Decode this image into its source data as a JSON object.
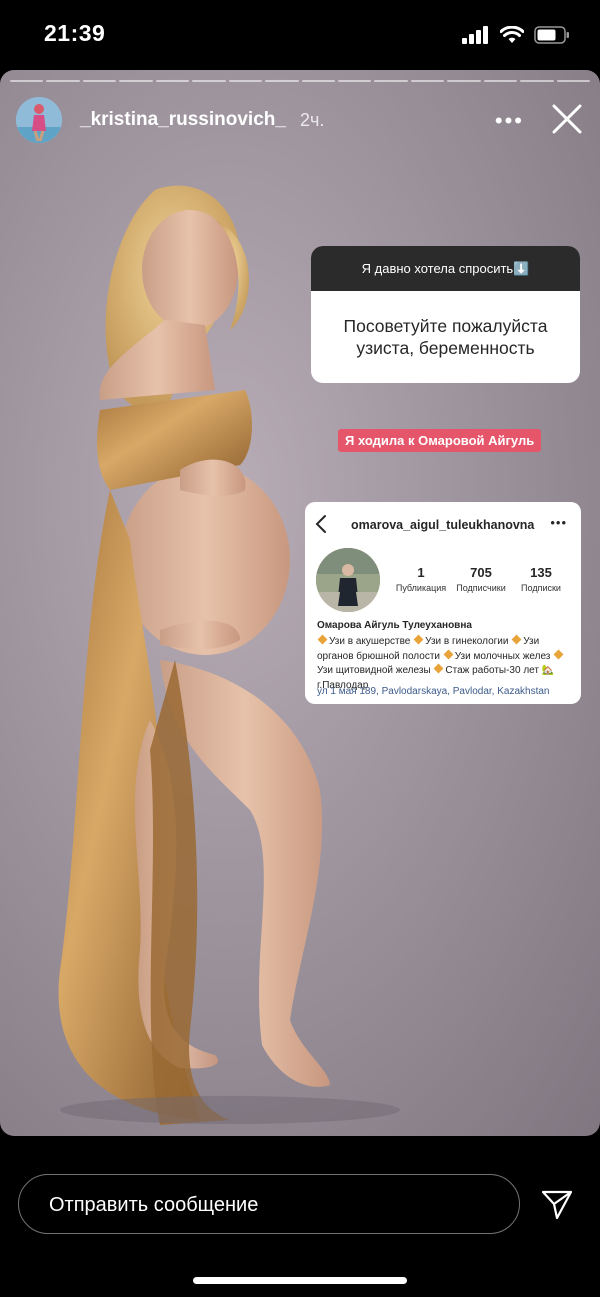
{
  "status_bar": {
    "time": "21:39",
    "signal_icon": "cellular-signal-icon",
    "wifi_icon": "wifi-icon",
    "battery_icon": "battery-icon"
  },
  "story": {
    "segments": 16,
    "username": "_kristina_russinovich_",
    "time_ago": "2ч.",
    "more_icon": "more-dots-icon",
    "close_icon": "close-icon",
    "question_sticker": {
      "prompt": "Я давно хотела спросить⬇️",
      "question": "Посоветуйте пожалуйста узиста, беременность"
    },
    "answer_tag": "Я ходила к Омаровой Айгуль",
    "profile_screenshot": {
      "handle": "omarova_aigul_tuleukhanovna",
      "more": "•••",
      "stats": [
        {
          "value": "1",
          "label": "Публикация"
        },
        {
          "value": "705",
          "label": "Подписчики"
        },
        {
          "value": "135",
          "label": "Подписки"
        }
      ],
      "full_name": "Омарова Айгуль Тулеухановна",
      "bio_items": [
        "Узи в акушерстве",
        "Узи в гинекологии",
        "Узи органов брюшной полости",
        "Узи молочных желез",
        "Узи щитовидной железы",
        "Стаж работы-30 лет"
      ],
      "bio_location": "🏡г.Павлодар",
      "address": "ул 1 мая 189, Pavlodarskaya, Pavlodar, Kazakhstan"
    }
  },
  "reply": {
    "placeholder": "Отправить сообщение",
    "send_icon": "send-icon"
  }
}
